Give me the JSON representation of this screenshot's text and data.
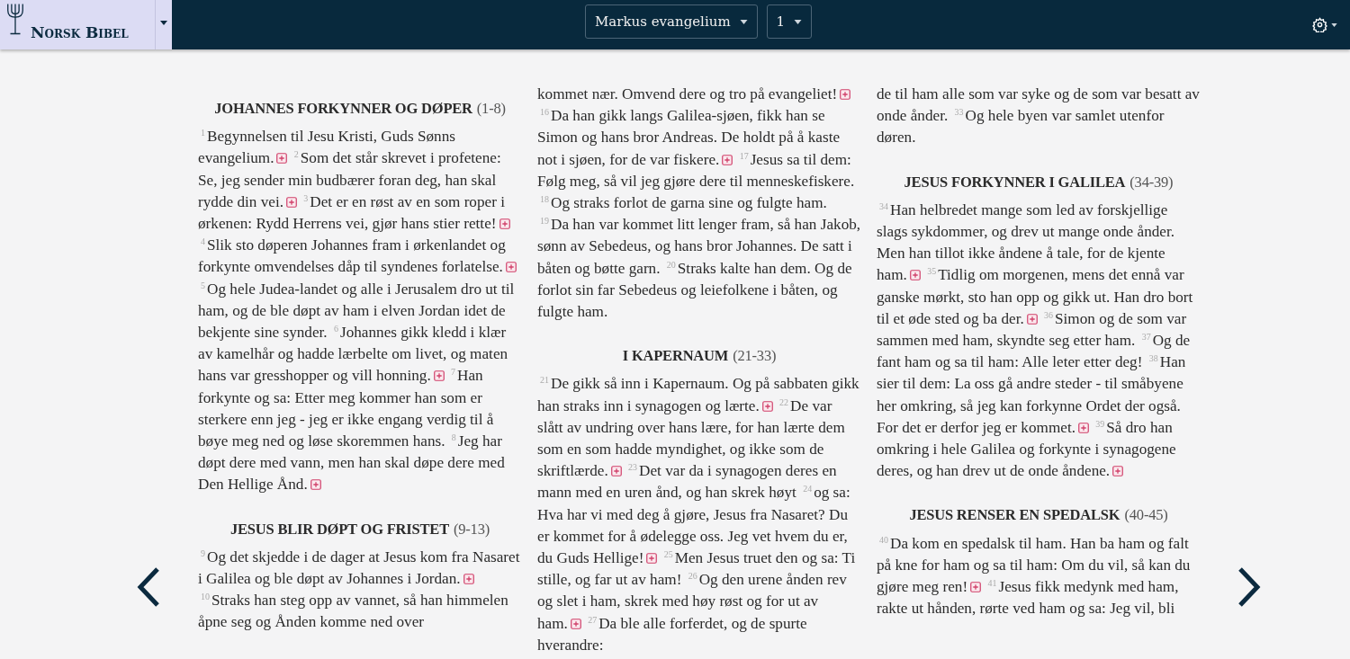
{
  "header": {
    "title": "Norsk Bibel",
    "book": "Markus evangelium",
    "chapter": "1"
  },
  "columns": [
    {
      "blocks": [
        {
          "kind": "heading",
          "title": "JOHANNES FORKYNNER OG DØPER",
          "range": "(1-8)"
        },
        {
          "kind": "paragraph",
          "verses": [
            {
              "number": "1",
              "text": "Begynnelsen til Jesu Kristi, Guds Sønns evangelium.",
              "note": true
            },
            {
              "number": "2",
              "text": "Som det står skrevet i profetene: Se, jeg sender min budbærer foran deg, han skal rydde din vei.",
              "note": true
            },
            {
              "number": "3",
              "text": "Det er en røst av en som roper i ørkenen: Rydd Herrens vei, gjør hans stier rette!",
              "note": true
            },
            {
              "number": "4",
              "text": "Slik sto døperen Johannes fram i ørkenlandet og forkynte omvendelses dåp til syndenes forlatelse.",
              "note": true
            },
            {
              "number": "5",
              "text": "Og hele Judea-landet og alle i Jerusalem dro ut til ham, og de ble døpt av ham i elven Jordan idet de bekjente sine synder.",
              "note": false
            },
            {
              "number": "6",
              "text": "Johannes gikk kledd i klær av kamelhår og hadde lærbelte om livet, og maten hans var gresshopper og vill honning.",
              "note": true
            },
            {
              "number": "7",
              "text": "Han forkynte og sa: Etter meg kommer han som er sterkere enn jeg - jeg er ikke engang verdig til å bøye meg ned og løse skoremmen hans.",
              "note": false
            },
            {
              "number": "8",
              "text": "Jeg har døpt dere med vann, men han skal døpe dere med Den Hellige Ånd.",
              "note": true
            }
          ]
        },
        {
          "kind": "heading",
          "title": "JESUS BLIR DØPT OG FRISTET",
          "range": "(9-13)"
        },
        {
          "kind": "paragraph",
          "verses": [
            {
              "number": "9",
              "text": "Og det skjedde i de dager at Jesus kom fra Nasaret i Galilea og ble døpt av Johannes i Jordan.",
              "note": true
            },
            {
              "number": "10",
              "text": "Straks han steg opp av vannet, så han himmelen åpne seg og Ånden komme ned over",
              "note": false
            }
          ]
        }
      ]
    },
    {
      "blocks": [
        {
          "kind": "paragraph",
          "verses": [
            {
              "text": "kommet nær. Omvend dere og tro på evangeliet!",
              "note": true
            },
            {
              "number": "16",
              "text": "Da han gikk langs Galilea-sjøen, fikk han se Simon og hans bror Andreas. De holdt på å kaste not i sjøen, for de var fiskere.",
              "note": true
            },
            {
              "number": "17",
              "text": "Jesus sa til dem: Følg meg, så vil jeg gjøre dere til menneskefiskere.",
              "note": false
            },
            {
              "number": "18",
              "text": "Og straks forlot de garna sine og fulgte ham.",
              "note": false
            },
            {
              "number": "19",
              "text": "Da han var kommet litt lenger fram, så han Jakob, sønn av Sebedeus, og hans bror Johannes. De satt i båten og bøtte garn.",
              "note": false
            },
            {
              "number": "20",
              "text": "Straks kalte han dem. Og de forlot sin far Sebedeus og leiefolkene i båten, og fulgte ham.",
              "note": false
            }
          ]
        },
        {
          "kind": "heading",
          "title": "I KAPERNAUM",
          "range": "(21-33)"
        },
        {
          "kind": "paragraph",
          "verses": [
            {
              "number": "21",
              "text": "De gikk så inn i Kapernaum. Og på sabbaten gikk han straks inn i synagogen og lærte.",
              "note": true
            },
            {
              "number": "22",
              "text": "De var slått av undring over hans lære, for han lærte dem som en som hadde myndighet, og ikke som de skriftlærde.",
              "note": true
            },
            {
              "number": "23",
              "text": "Det var da i synagogen deres en mann med en uren ånd, og han skrek høyt",
              "note": false
            },
            {
              "number": "24",
              "text": "og sa: Hva har vi med deg å gjøre, Jesus fra Nasaret? Du er kommet for å ødelegge oss. Jeg vet hvem du er, du Guds Hellige!",
              "note": true
            },
            {
              "number": "25",
              "text": "Men Jesus truet den og sa: Ti stille, og far ut av ham!",
              "note": false
            },
            {
              "number": "26",
              "text": "Og den urene ånden rev og slet i ham, skrek med høy røst og for ut av ham.",
              "note": true
            },
            {
              "number": "27",
              "text": "Da ble alle forferdet, og de spurte hverandre:",
              "note": false
            }
          ]
        }
      ]
    },
    {
      "blocks": [
        {
          "kind": "paragraph",
          "verses": [
            {
              "text": "de til ham alle som var syke og de som var besatt av onde ånder.",
              "note": false
            },
            {
              "number": "33",
              "text": "Og hele byen var samlet utenfor døren.",
              "note": false
            }
          ]
        },
        {
          "kind": "heading",
          "title": "JESUS FORKYNNER I GALILEA",
          "range": "(34-39)"
        },
        {
          "kind": "paragraph",
          "verses": [
            {
              "number": "34",
              "text": "Han helbredet mange som led av forskjellige slags sykdommer, og drev ut mange onde ånder. Men han tillot ikke åndene å tale, for de kjente ham.",
              "note": true
            },
            {
              "number": "35",
              "text": "Tidlig om morgenen, mens det ennå var ganske mørkt, sto han opp og gikk ut. Han dro bort til et øde sted og ba der.",
              "note": true
            },
            {
              "number": "36",
              "text": "Simon og de som var sammen med ham, skyndte seg etter ham.",
              "note": false
            },
            {
              "number": "37",
              "text": "Og de fant ham og sa til ham: Alle leter etter deg!",
              "note": false
            },
            {
              "number": "38",
              "text": "Han sier til dem: La oss gå andre steder - til småbyene her omkring, så jeg kan forkynne Ordet der også. For det er derfor jeg er kommet.",
              "note": true
            },
            {
              "number": "39",
              "text": "Så dro han omkring i hele Galilea og forkynte i synagogene deres, og han drev ut de onde åndene.",
              "note": true
            }
          ]
        },
        {
          "kind": "heading",
          "title": "JESUS RENSER EN SPEDALSK",
          "range": "(40-45)"
        },
        {
          "kind": "paragraph",
          "verses": [
            {
              "number": "40",
              "text": "Da kom en spedalsk til ham. Han ba ham og falt på kne for ham og sa til ham: Om du vil, så kan du gjøre meg ren!",
              "note": true
            },
            {
              "number": "41",
              "text": "Jesus fikk medynk med ham, rakte ut hånden, rørte ved ham og sa: Jeg vil, bli",
              "note": false
            }
          ]
        }
      ]
    }
  ]
}
